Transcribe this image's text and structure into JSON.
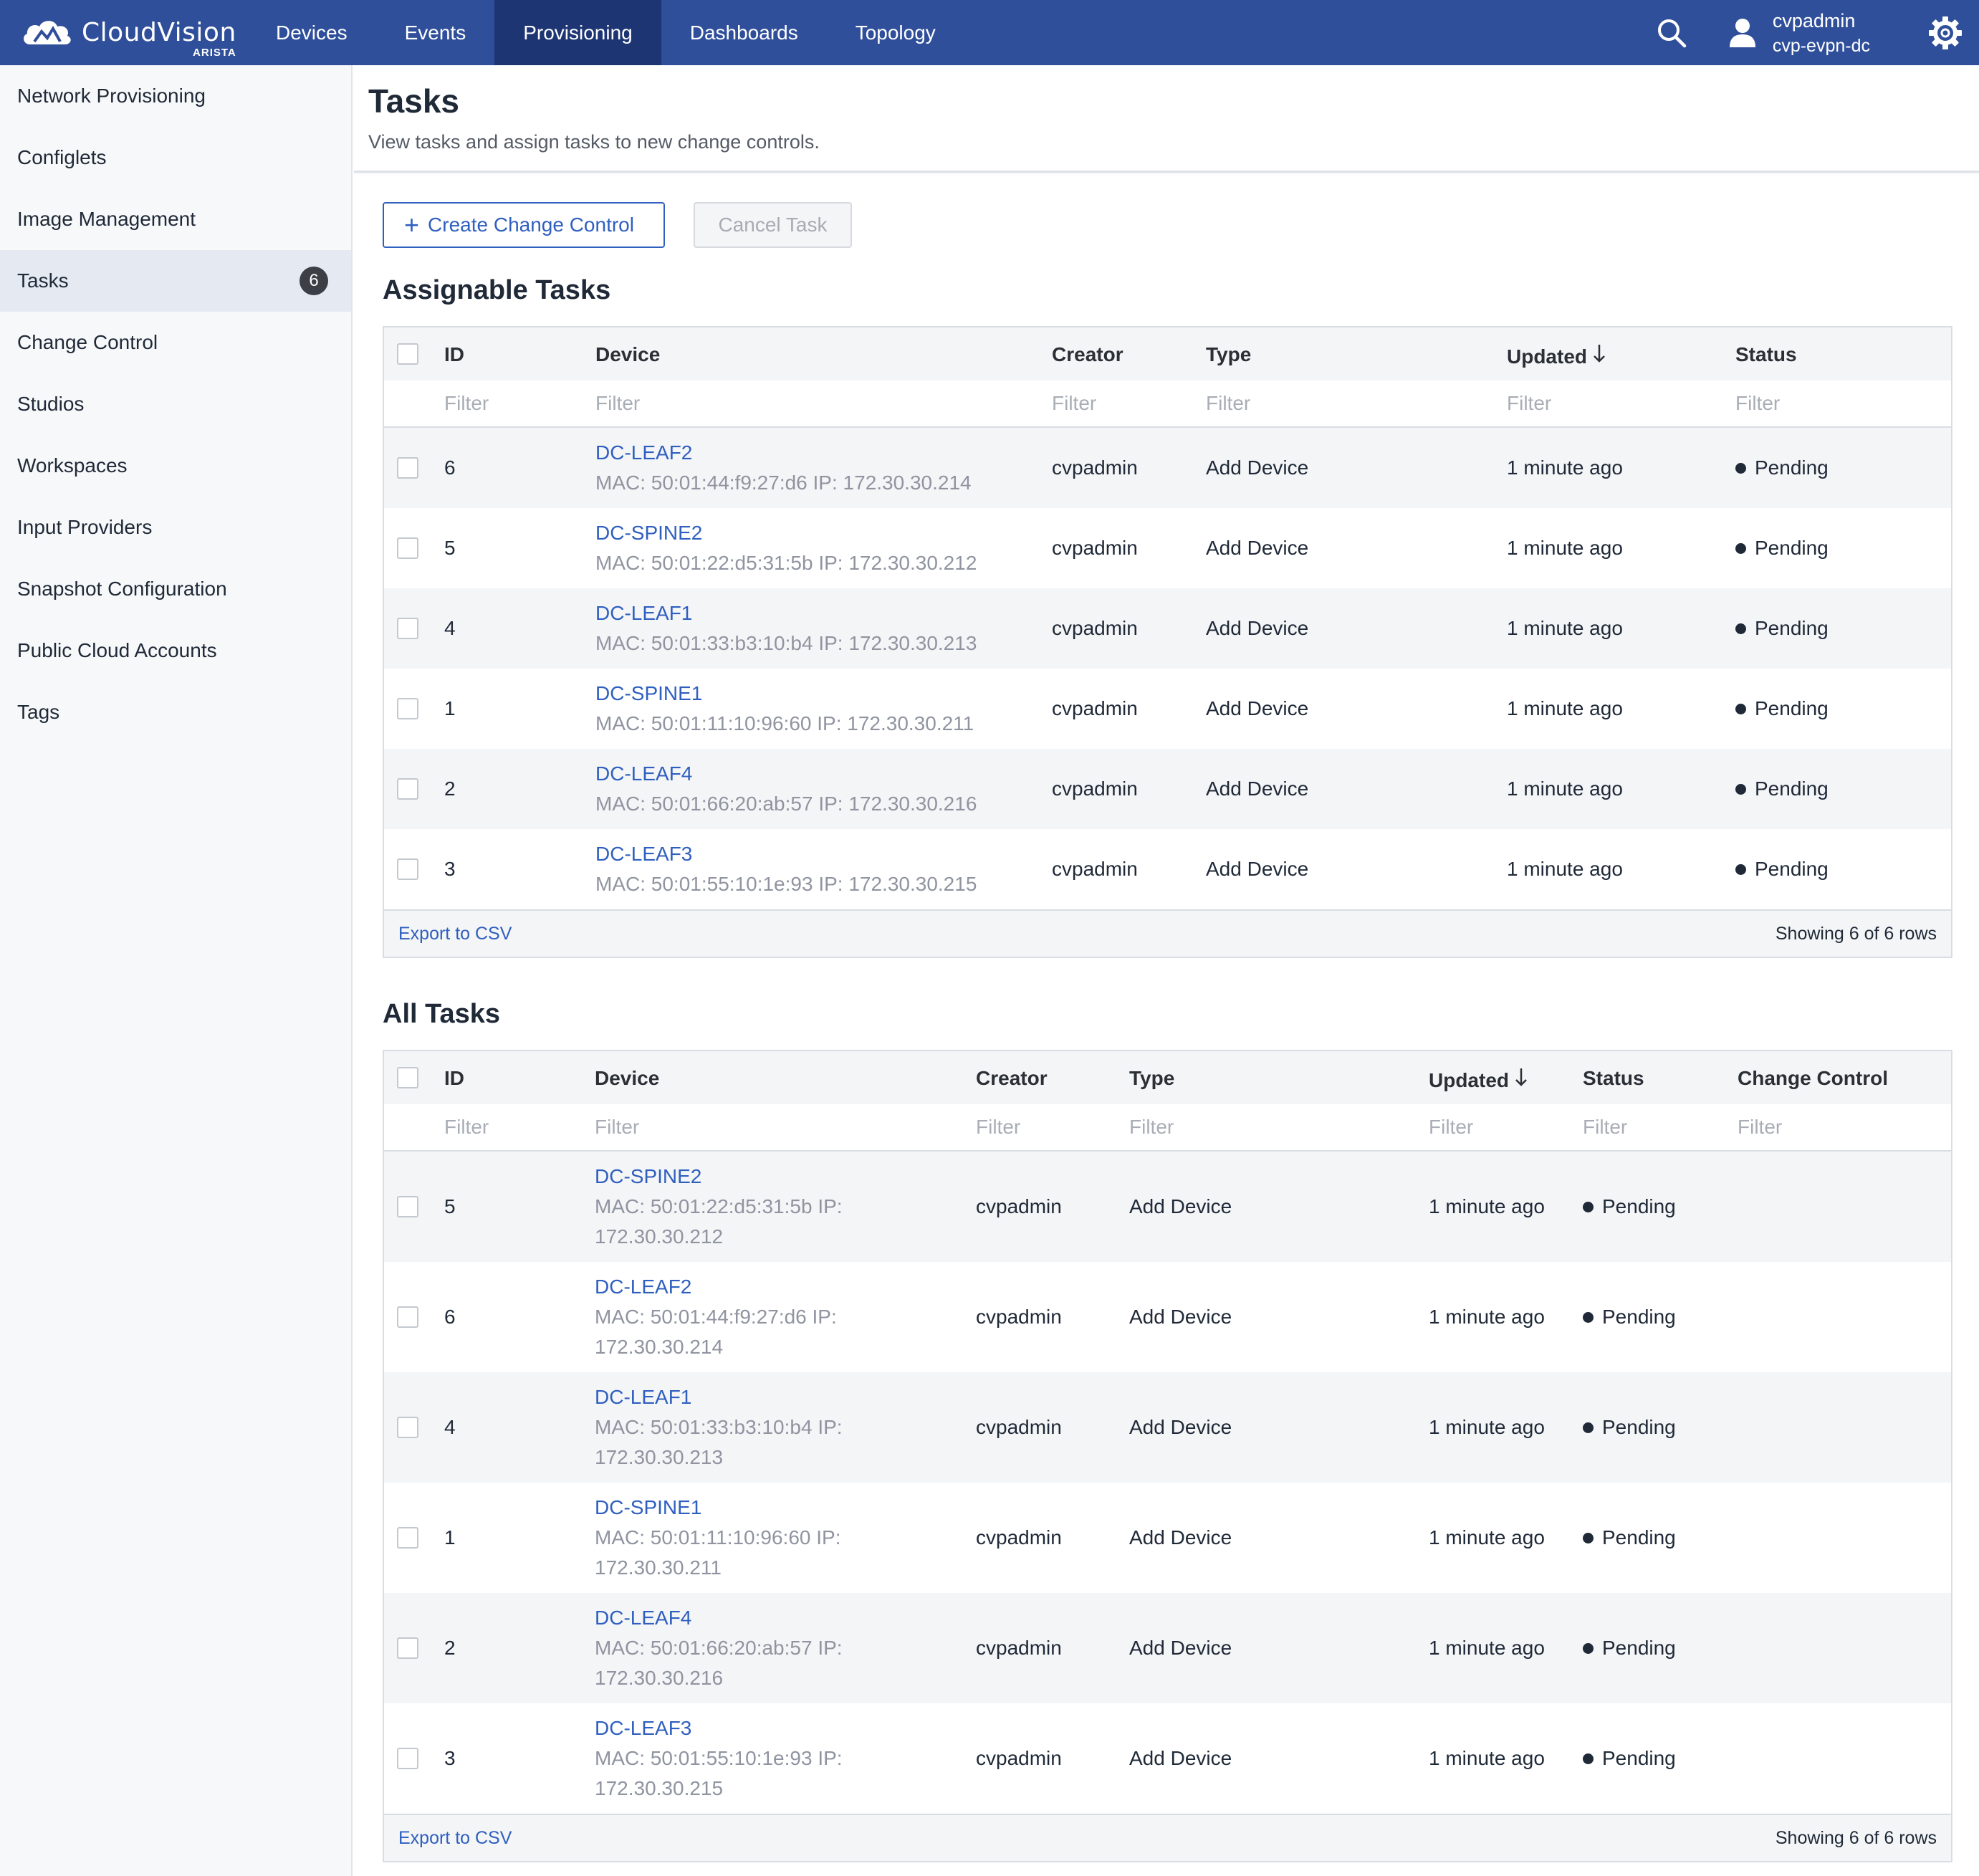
{
  "brand": {
    "name": "CloudVision",
    "sub": "ARISTA"
  },
  "nav": {
    "tabs": [
      "Devices",
      "Events",
      "Provisioning",
      "Dashboards",
      "Topology"
    ],
    "active_tab": "Provisioning",
    "user": "cvpadmin",
    "host": "cvp-evpn-dc"
  },
  "sidebar": {
    "items": [
      {
        "label": "Network Provisioning"
      },
      {
        "label": "Configlets"
      },
      {
        "label": "Image Management"
      },
      {
        "label": "Tasks",
        "badge": "6",
        "active": true
      },
      {
        "label": "Change Control"
      },
      {
        "label": "Studios"
      },
      {
        "label": "Workspaces"
      },
      {
        "label": "Input Providers"
      },
      {
        "label": "Snapshot Configuration"
      },
      {
        "label": "Public Cloud Accounts"
      },
      {
        "label": "Tags"
      }
    ]
  },
  "page": {
    "title": "Tasks",
    "subtitle": "View tasks and assign tasks to new change controls."
  },
  "actions": {
    "create_label": "Create Change Control",
    "cancel_label": "Cancel Task"
  },
  "assignable": {
    "title": "Assignable Tasks",
    "columns": {
      "id": "ID",
      "device": "Device",
      "creator": "Creator",
      "type": "Type",
      "updated": "Updated",
      "status": "Status"
    },
    "filter_placeholder": "Filter",
    "rows": [
      {
        "id": "6",
        "device": "DC-LEAF2",
        "meta": "MAC: 50:01:44:f9:27:d6 IP: 172.30.30.214",
        "creator": "cvpadmin",
        "type": "Add Device",
        "updated": "1 minute ago",
        "status": "Pending"
      },
      {
        "id": "5",
        "device": "DC-SPINE2",
        "meta": "MAC: 50:01:22:d5:31:5b IP: 172.30.30.212",
        "creator": "cvpadmin",
        "type": "Add Device",
        "updated": "1 minute ago",
        "status": "Pending"
      },
      {
        "id": "4",
        "device": "DC-LEAF1",
        "meta": "MAC: 50:01:33:b3:10:b4 IP: 172.30.30.213",
        "creator": "cvpadmin",
        "type": "Add Device",
        "updated": "1 minute ago",
        "status": "Pending"
      },
      {
        "id": "1",
        "device": "DC-SPINE1",
        "meta": "MAC: 50:01:11:10:96:60 IP: 172.30.30.211",
        "creator": "cvpadmin",
        "type": "Add Device",
        "updated": "1 minute ago",
        "status": "Pending"
      },
      {
        "id": "2",
        "device": "DC-LEAF4",
        "meta": "MAC: 50:01:66:20:ab:57 IP: 172.30.30.216",
        "creator": "cvpadmin",
        "type": "Add Device",
        "updated": "1 minute ago",
        "status": "Pending"
      },
      {
        "id": "3",
        "device": "DC-LEAF3",
        "meta": "MAC: 50:01:55:10:1e:93 IP: 172.30.30.215",
        "creator": "cvpadmin",
        "type": "Add Device",
        "updated": "1 minute ago",
        "status": "Pending"
      }
    ],
    "export_label": "Export to CSV",
    "showing": "Showing 6 of 6 rows"
  },
  "all": {
    "title": "All Tasks",
    "columns": {
      "id": "ID",
      "device": "Device",
      "creator": "Creator",
      "type": "Type",
      "updated": "Updated",
      "status": "Status",
      "change_control": "Change Control"
    },
    "filter_placeholder": "Filter",
    "rows": [
      {
        "id": "5",
        "device": "DC-SPINE2",
        "meta1": "MAC: 50:01:22:d5:31:5b IP:",
        "meta2": "172.30.30.212",
        "creator": "cvpadmin",
        "type": "Add Device",
        "updated": "1 minute ago",
        "status": "Pending"
      },
      {
        "id": "6",
        "device": "DC-LEAF2",
        "meta1": "MAC: 50:01:44:f9:27:d6 IP:",
        "meta2": "172.30.30.214",
        "creator": "cvpadmin",
        "type": "Add Device",
        "updated": "1 minute ago",
        "status": "Pending"
      },
      {
        "id": "4",
        "device": "DC-LEAF1",
        "meta1": "MAC: 50:01:33:b3:10:b4 IP:",
        "meta2": "172.30.30.213",
        "creator": "cvpadmin",
        "type": "Add Device",
        "updated": "1 minute ago",
        "status": "Pending"
      },
      {
        "id": "1",
        "device": "DC-SPINE1",
        "meta1": "MAC: 50:01:11:10:96:60 IP:",
        "meta2": "172.30.30.211",
        "creator": "cvpadmin",
        "type": "Add Device",
        "updated": "1 minute ago",
        "status": "Pending"
      },
      {
        "id": "2",
        "device": "DC-LEAF4",
        "meta1": "MAC: 50:01:66:20:ab:57 IP:",
        "meta2": "172.30.30.216",
        "creator": "cvpadmin",
        "type": "Add Device",
        "updated": "1 minute ago",
        "status": "Pending"
      },
      {
        "id": "3",
        "device": "DC-LEAF3",
        "meta1": "MAC: 50:01:55:10:1e:93 IP:",
        "meta2": "172.30.30.215",
        "creator": "cvpadmin",
        "type": "Add Device",
        "updated": "1 minute ago",
        "status": "Pending"
      }
    ],
    "export_label": "Export to CSV",
    "showing": "Showing 6 of 6 rows"
  },
  "icons": {
    "logo": "cloud-logo-icon",
    "search": "search-icon",
    "user": "user-icon",
    "settings": "gear-icon",
    "sort": "arrow-down-icon",
    "status": "status-dot-icon"
  },
  "colors": {
    "nav_bg": "#2f4f9a",
    "nav_active": "#1e3574",
    "link": "#2f5fbf",
    "badge": "#3c3f45"
  }
}
